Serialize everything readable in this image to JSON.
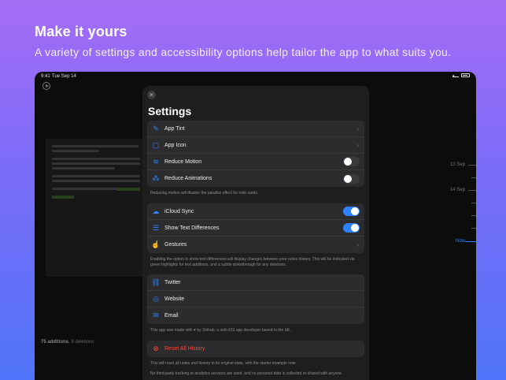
{
  "promo": {
    "headline": "Make it yours",
    "subline": "A variety of settings and accessibility options help tailor the app to what suits you."
  },
  "statusbar": {
    "time": "9:41",
    "date": "Tue Sep 14"
  },
  "background": {
    "title": "",
    "footer_additions": "75 additions",
    "footer_deletions": "8 deletions",
    "timeline": [
      "13 Sep",
      "14 Sep",
      "Now"
    ]
  },
  "settings": {
    "title": "Settings",
    "appearance": [
      {
        "label": "App Tint",
        "icon": "brush-icon",
        "control": "chevron"
      },
      {
        "label": "App Icon",
        "icon": "app-icon-icon",
        "control": "chevron"
      },
      {
        "label": "Reduce Motion",
        "icon": "motion-icon",
        "control": "toggle",
        "on": false
      },
      {
        "label": "Reduce Animations",
        "icon": "animation-icon",
        "control": "toggle",
        "on": false
      }
    ],
    "appearance_note": "Reducing motion will disable the parallax effect for note cards.",
    "sync": [
      {
        "label": "iCloud Sync",
        "icon": "cloud-icon",
        "control": "toggle",
        "on": true
      },
      {
        "label": "Show Text Differences",
        "icon": "differences-icon",
        "control": "toggle",
        "on": true
      },
      {
        "label": "Gestures",
        "icon": "hand-icon",
        "control": "chevron"
      }
    ],
    "sync_note": "Enabling the option to show text differences will display changes between your notes history. This will be indicated via green highlights for text additions, and a subtle strikethrough for any deletions.",
    "links": [
      {
        "label": "Twitter",
        "icon": "link-icon"
      },
      {
        "label": "Website",
        "icon": "compass-icon"
      },
      {
        "label": "Email",
        "icon": "mail-icon"
      }
    ],
    "links_note": "This app was made with ♥ by Shihab, a solo iOS app developer based in the UK.",
    "reset_label": "Reset All History",
    "reset_note": "This will reset all notes and history to its original state, with the starter example note.",
    "privacy_note": "No third-party tracking or analytics services are used, and no personal data is collected or shared with anyone."
  },
  "colors": {
    "accent": "#2e82ff",
    "danger": "#ff453a",
    "sheet": "#1e1e1f",
    "row": "#2c2c2e"
  }
}
